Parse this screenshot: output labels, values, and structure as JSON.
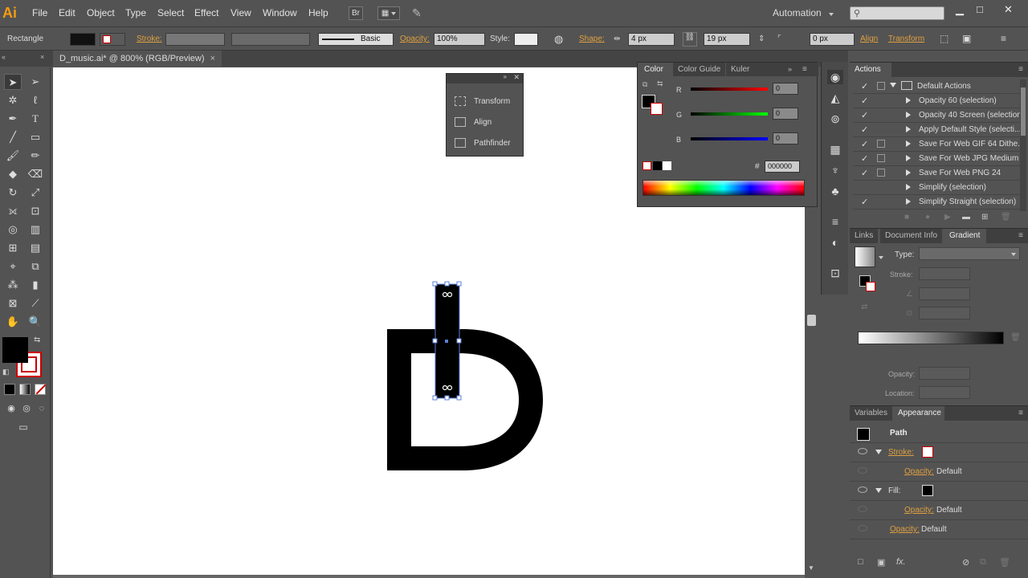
{
  "app": {
    "logo": "Ai",
    "workspace": "Automation"
  },
  "menu": [
    "File",
    "Edit",
    "Object",
    "Type",
    "Select",
    "Effect",
    "View",
    "Window",
    "Help"
  ],
  "menu_buttons": {
    "bridge": "Br"
  },
  "control_bar": {
    "object_type": "Rectangle",
    "stroke_label": "Stroke:",
    "brush_label": "Basic",
    "opacity_label": "Opacity:",
    "opacity_value": "100%",
    "style_label": "Style:",
    "shape_label": "Shape:",
    "width_value": "4 px",
    "height_value": "19 px",
    "corner_value": "0 px",
    "align_link": "Align",
    "transform_link": "Transform"
  },
  "document": {
    "tab_title": "D_music.ai* @ 800% (RGB/Preview)",
    "letter": "D"
  },
  "floating_panel": {
    "items": [
      "Transform",
      "Align",
      "Pathfinder"
    ]
  },
  "color_panel": {
    "tabs": [
      "Color",
      "Color Guide",
      "Kuler"
    ],
    "channels": [
      {
        "label": "R",
        "value": "0",
        "color": "#ff0000"
      },
      {
        "label": "G",
        "value": "0",
        "color": "#00ff00"
      },
      {
        "label": "B",
        "value": "0",
        "color": "#0000ff"
      }
    ],
    "hex_label": "#",
    "hex_value": "000000"
  },
  "actions_panel": {
    "title": "Actions",
    "items": [
      {
        "label": "Default Actions",
        "checked": true,
        "dialog": true,
        "folder": true
      },
      {
        "label": "Opacity 60 (selection)",
        "checked": true,
        "dialog": false
      },
      {
        "label": "Opacity 40 Screen (selection)",
        "checked": true,
        "dialog": false
      },
      {
        "label": "Apply Default Style (selecti...",
        "checked": true,
        "dialog": false
      },
      {
        "label": "Save For Web GIF 64 Dithe...",
        "checked": true,
        "dialog": true
      },
      {
        "label": "Save For Web JPG Medium",
        "checked": true,
        "dialog": true
      },
      {
        "label": "Save For Web PNG 24",
        "checked": true,
        "dialog": true
      },
      {
        "label": "Simplify (selection)",
        "checked": false,
        "dialog": false
      },
      {
        "label": "Simplify Straight (selection)",
        "checked": true,
        "dialog": false
      }
    ]
  },
  "gradient_panel": {
    "tabs": [
      "Links",
      "Document Info",
      "Gradient"
    ],
    "type_label": "Type:",
    "stroke_label": "Stroke:",
    "opacity_label": "Opacity:",
    "location_label": "Location:"
  },
  "appearance_panel": {
    "tabs": [
      "Variables",
      "Appearance"
    ],
    "title": "Path",
    "stroke_label": "Stroke:",
    "fill_label": "Fill:",
    "opacity_label": "Opacity:",
    "opacity_value": "Default"
  },
  "icons": [
    "selection-tool",
    "direct-selection-tool",
    "pen-tool",
    "type-tool",
    "zoom-tool",
    "hand-tool"
  ]
}
